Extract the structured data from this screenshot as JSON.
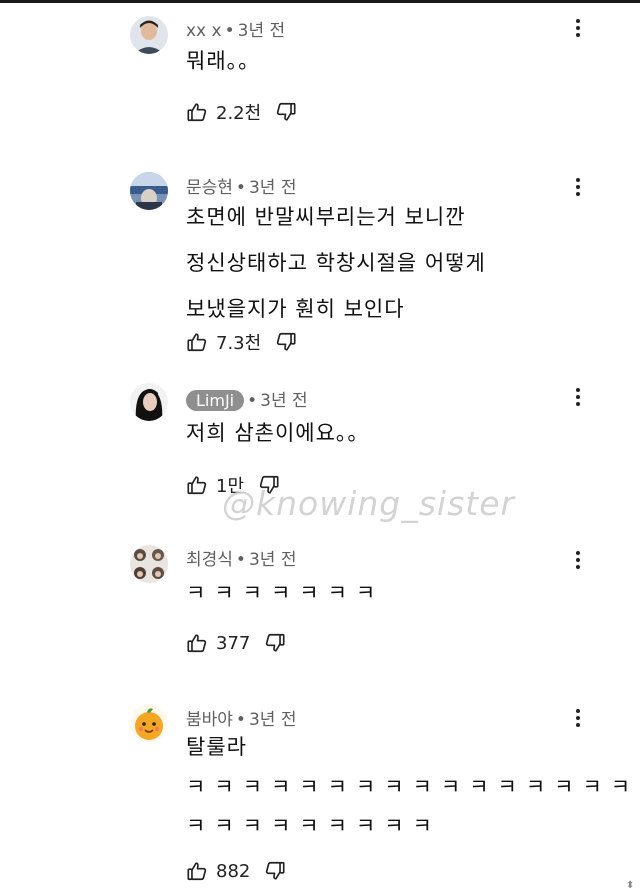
{
  "watermark": "@knowing_sister",
  "comments": [
    {
      "author": "xx x",
      "time": "3년 전",
      "lines": [
        "뭐래。。"
      ],
      "likes": "2.2천",
      "avatar": "photo-young-man"
    },
    {
      "author": "문승현",
      "time": "3년 전",
      "lines": [
        "초면에 반말씨부리는거 보니깐",
        "정신상태하고 학창시절을 어떻게",
        "보냈을지가 훤히 보인다"
      ],
      "likes": "7.3천",
      "avatar": "photo-outdoor"
    },
    {
      "author": "LimJi",
      "time": "3년 전",
      "lines": [
        "저희 삼촌이에요。。"
      ],
      "likes": "1만",
      "avatar": "photo-dark-hair"
    },
    {
      "author": "최경식",
      "time": "3년 전",
      "lines": [
        "ㅋㅋㅋㅋㅋㅋㅋ"
      ],
      "likes": "377",
      "avatar": "photo-grid"
    },
    {
      "author": "붐바야",
      "time": "3년 전",
      "lines": [
        "탈룰라",
        "ㅋㅋㅋㅋㅋㅋㅋㅋㅋㅋㅋㅋㅋㅋㅋㅋ",
        "ㅋㅋㅋㅋㅋㅋㅋㅋㅋ"
      ],
      "likes": "882",
      "avatar": "orange-character"
    }
  ],
  "icons": {
    "like": "thumbs-up-icon",
    "dislike": "thumbs-down-icon",
    "more": "more-vert-icon"
  }
}
